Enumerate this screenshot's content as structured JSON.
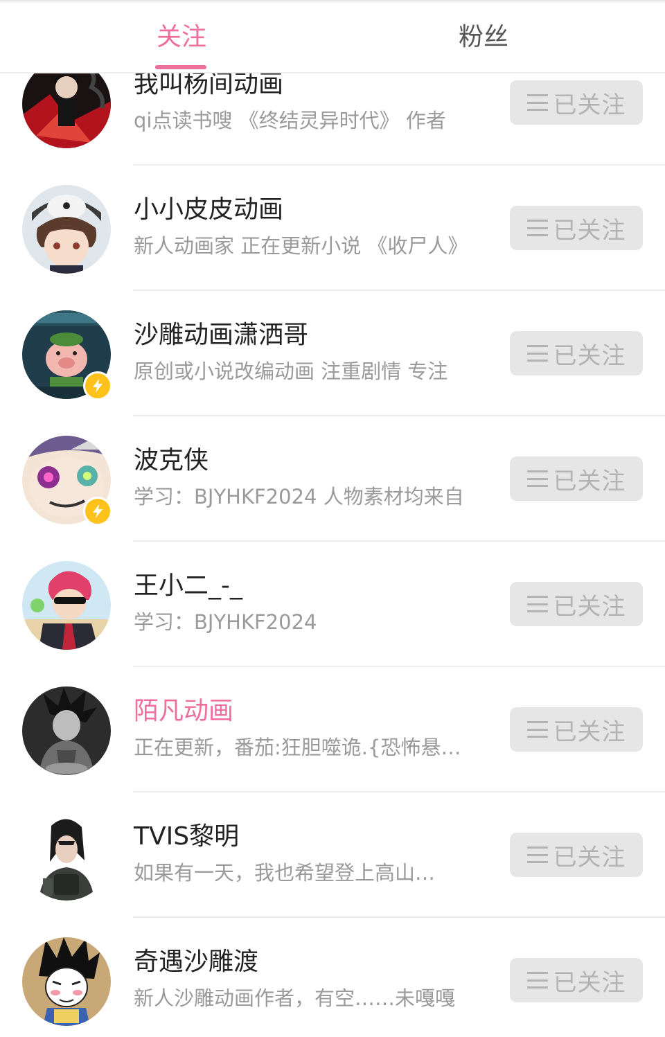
{
  "tabs": [
    {
      "label": "关注",
      "active": true
    },
    {
      "label": "粉丝",
      "active": false
    }
  ],
  "colors": {
    "accent": "#ee6e9c",
    "badge": "#ffc21a",
    "button_bg": "#e6e6e6"
  },
  "follow_button_icon": "menu-icon",
  "users": [
    {
      "name": "我叫杨间动画",
      "bio": "qi点读书嗖 《终结灵异时代》 作者",
      "button": "已关注",
      "highlight": false,
      "badge": false
    },
    {
      "name": "小小皮皮动画",
      "bio": "新人动画家 正在更新小说 《收尸人》",
      "button": "已关注",
      "highlight": false,
      "badge": false
    },
    {
      "name": "沙雕动画潇洒哥",
      "bio": "原创或小说改编动画 注重剧情 专注",
      "button": "已关注",
      "highlight": false,
      "badge": true
    },
    {
      "name": "波克侠",
      "bio": "学习：BJYHKF2024 人物素材均来自",
      "button": "已关注",
      "highlight": false,
      "badge": true
    },
    {
      "name": "王小二_-_",
      "bio": "学习：BJYHKF2024",
      "button": "已关注",
      "highlight": false,
      "badge": false
    },
    {
      "name": "陌凡动画",
      "bio": "正在更新，番茄:狂胆噬诡.{恐怖悬疑}",
      "button": "已关注",
      "highlight": true,
      "badge": false
    },
    {
      "name": "TVIS黎明",
      "bio": "如果有一天，我也希望登上高山…",
      "button": "已关注",
      "highlight": false,
      "badge": false
    },
    {
      "name": "奇遇沙雕渡",
      "bio": "新人沙雕动画作者，有空……未嘎嘎",
      "button": "已关注",
      "highlight": false,
      "badge": false
    }
  ]
}
